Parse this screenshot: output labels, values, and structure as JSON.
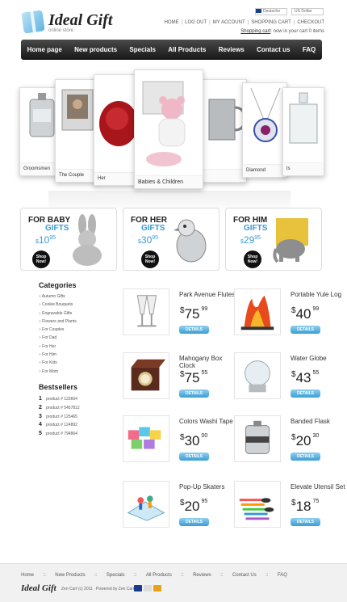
{
  "header": {
    "logo_title": "Ideal Gift",
    "logo_subtitle": "online store",
    "top_links": [
      "HOME",
      "LOG OUT",
      "MY ACCOUNT",
      "SHOPPING CART",
      "CHECKOUT"
    ],
    "language": "Deutsche",
    "currency": "US Dollar",
    "cart_link": "Shopping cart",
    "cart_text": ": now in your cart 0 items"
  },
  "nav": [
    "Home page",
    "New products",
    "Specials",
    "All Products",
    "Reviews",
    "Contact us",
    "FAQ"
  ],
  "slider": {
    "captions": [
      "Groomsmen",
      "The Couple",
      "Her",
      "Babies & Children",
      "",
      "Diamond",
      "ts"
    ]
  },
  "promos": [
    {
      "line1": "FOR BABY",
      "line2": "GIFTS",
      "price": "10",
      "cents": "95",
      "shop": "Shop Now!",
      "currency": "$"
    },
    {
      "line1": "FOR HER",
      "line2": "GIFTS",
      "price": "30",
      "cents": "95",
      "shop": "Shop Now!",
      "currency": "$"
    },
    {
      "line1": "FOR HIM",
      "line2": "GIFTS",
      "price": "29",
      "cents": "95",
      "shop": "Shop Now!",
      "currency": "$"
    }
  ],
  "categories": {
    "title": "Categories",
    "items": [
      "Autumn Gifts",
      "Cookie Bouquets",
      "Engravable Gifts",
      "Flowers and Plants",
      "For Couples",
      "For Dad",
      "For Her",
      "For Him",
      "For Kids",
      "For Mom"
    ]
  },
  "bestsellers": {
    "title": "Bestsellers",
    "items": [
      {
        "num": "1",
        "label": "product # 123664"
      },
      {
        "num": "2",
        "label": "product # 5457812"
      },
      {
        "num": "3",
        "label": "product # 125465"
      },
      {
        "num": "4",
        "label": "product # 124892"
      },
      {
        "num": "5",
        "label": "product # 794864"
      }
    ]
  },
  "products": [
    {
      "name": "Park Avenue Flutes",
      "dollars": "75",
      "cents": "99",
      "button": "DETAILS"
    },
    {
      "name": "Portable Yule Log",
      "dollars": "40",
      "cents": "99",
      "button": "DETAILS"
    },
    {
      "name": "Mahogany Box Clock",
      "dollars": "75",
      "cents": "55",
      "button": "DETAILS"
    },
    {
      "name": "Water Globe",
      "dollars": "43",
      "cents": "55",
      "button": "DETAILS"
    },
    {
      "name": "Colors Washi Tape",
      "dollars": "30",
      "cents": "00",
      "button": "DETAILS"
    },
    {
      "name": "Banded Flask",
      "dollars": "20",
      "cents": "30",
      "button": "DETAILS"
    },
    {
      "name": "Pop-Up Skaters",
      "dollars": "20",
      "cents": "95",
      "button": "DETAILS"
    },
    {
      "name": "Elevate Utensil Set",
      "dollars": "18",
      "cents": "75",
      "button": "DETAILS"
    }
  ],
  "price_symbol": "$",
  "footer": {
    "links": [
      "Home",
      "New Products",
      "Specials",
      "All Products",
      "Reviews",
      "Contact Us",
      "FAQ"
    ],
    "logo": "Ideal Gift",
    "copyright": "Zen Cart (c) 2011 . Powered by Zen Cart"
  },
  "colors": {
    "accent": "#3a9bd6",
    "nav_dark": "#1a1a1a"
  }
}
